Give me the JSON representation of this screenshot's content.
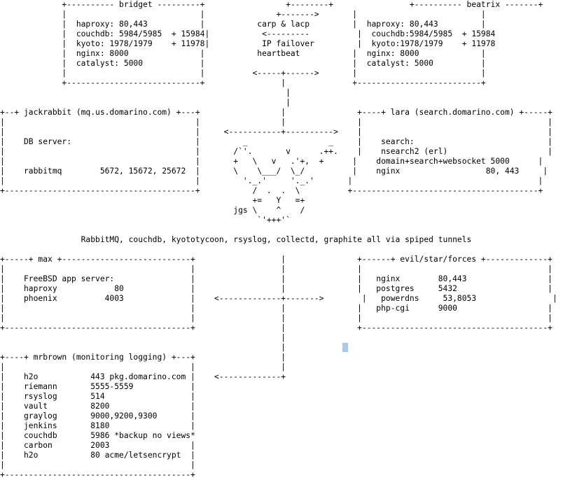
{
  "diagram": {
    "lines": [
      "             +---------- bridget ---------+                 +--------+                +---------- beatrix -------+",
      "             |                            |               +------->       |                          |",
      "             |  haproxy: 80,443           |           carp & lacp         |  haproxy: 80,443         |",
      "             |  couchdb: 5984/5985  + 15984|           <---------          |  couchdb:5984/5985  + 15984",
      "             |  kyoto: 1978/1979    + 11978|           IP failover         |  kyoto:1978/1979    + 11978",
      "             |  nginx: 8000               |           heartbeat           |  nginx: 8000             |",
      "             |  catalyst: 5000            |                               |  catalyst: 5000          |",
      "             |                            |          <-----+------>       |                          |",
      "             +----------------------------+                |              +--------------------------+",
      "                                                            |",
      "                                                            |",
      "+--+ jackrabbit (mq.us.domarino.com) +---+                 |               +----+ lara (search.domarino.com) +-----+",
      "|                                        |                 |               |                                       |",
      "|                                        |     <-----------+---------->    |                                       |",
      "|    DB server:                          |         _                 _     |    search:                            |",
      "|                                        |       /`'.       v      .++.    |    nsearch2 (erl)                     |",
      "|                                        |       +   \\   v   .'+,  +      |    domain+search+websocket 5000      |",
      "|    rabbitmq        5672, 15672, 25672  |       \\    \\___/  \\_/          |    nginx                  80, 443     |",
      "|                                        |         '._.'     '._.'       |                                       |",
      "+----------------------------------------+           /  .  .  \\          +---------------------------------------+",
      "                                                     +=   Y   =+",
      "                                                 jgs \\    ^    /",
      "                                                      `'+++'`",
      "",
      "                 RabbitMQ, couchdb, kyototycoon, rsyslog, collectd, graphite all via spiped tunnels",
      "",
      "+-----+ max +---------------------------+                  |               +------+ evil/star/forces +-------------+",
      "|                                       |                  |               |                                       |",
      "|    FreeBSD app server:                |                  |               |   nginx        80,443                 |",
      "|    haproxy            80              |                  |               |   postgres     5432                   |",
      "|    phoenix          4003              |    <-------------+------->        |   powerdns     53,8053                |",
      "|                                       |                  |               |   php-cgi      9000                   |",
      "|                                       |                  |               |                                       |",
      "+---------------------------------------+                  |               +---------------------------------------+",
      "                                                           |",
      "                                                           |",
      "+----+ mrbrown (monitoring logging) +---+                  |",
      "|                                       |                  |",
      "|    h2o           443 pkg.domarino.com |    <-------------+",
      "|    riemann       5555-5559            |",
      "|    rsyslog       514                  |",
      "|    vault         8200                 |",
      "|    graylog       9000,9200,9300       |",
      "|    jenkins       8180                 |",
      "|    couchdb       5986 *backup no views*",
      "|    carbon        2003                 |",
      "|    h2o           80 acme/letsencrypt  |",
      "|                                       |",
      "+---------------------------------------+"
    ]
  }
}
